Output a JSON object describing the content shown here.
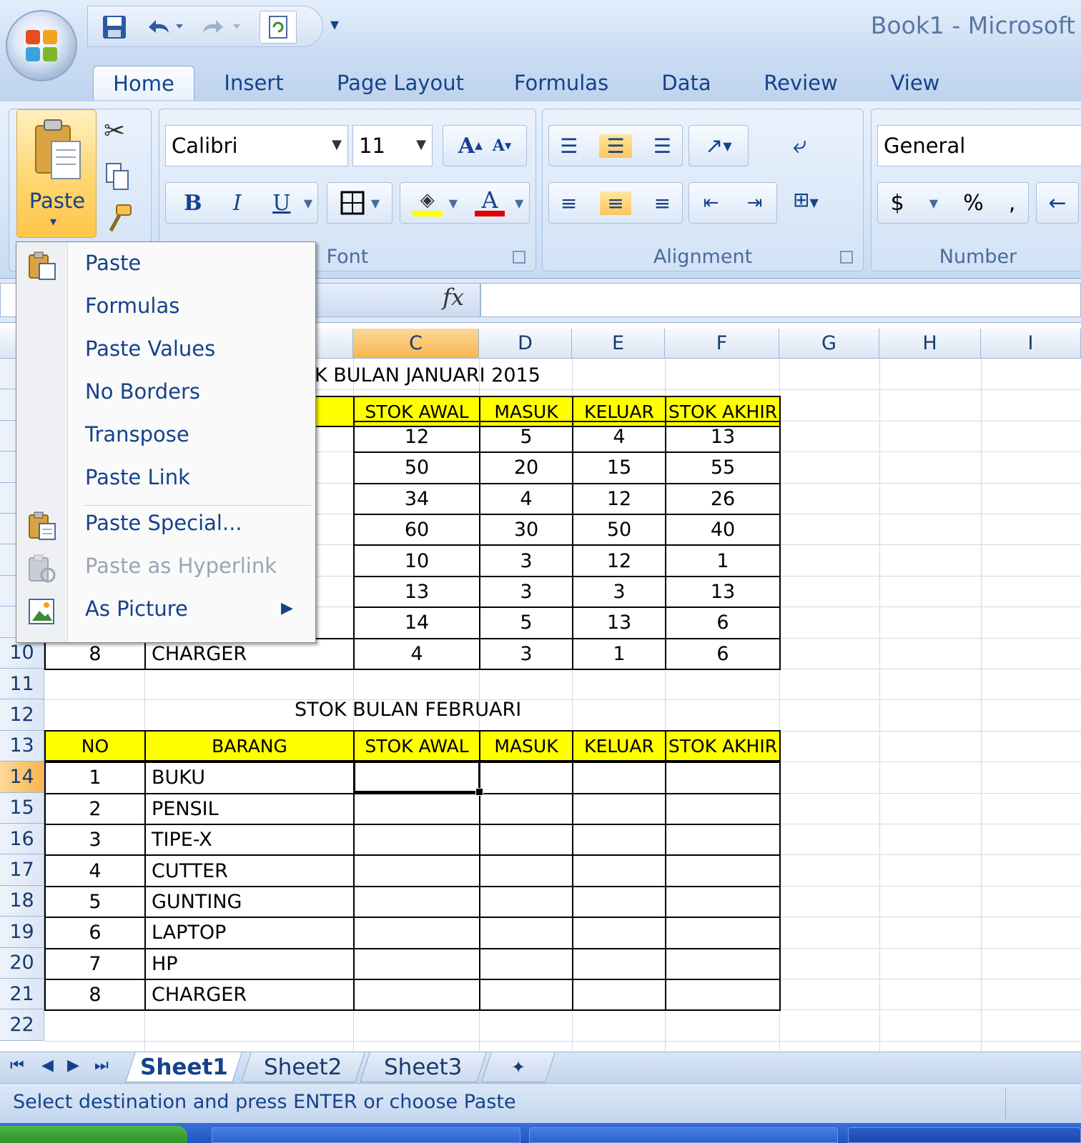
{
  "window": {
    "title": "Book1  -  Microsoft"
  },
  "ribbon_tabs": [
    "Home",
    "Insert",
    "Page Layout",
    "Formulas",
    "Data",
    "Review",
    "View"
  ],
  "clipboard": {
    "paste_label": "Paste"
  },
  "font": {
    "name": "Calibri",
    "size": "11",
    "bold": "B",
    "italic": "I",
    "underline": "U",
    "font_color_glyph": "A",
    "group_label": "Font",
    "grow": "A",
    "shrink": "A"
  },
  "alignment": {
    "group_label": "Alignment"
  },
  "number": {
    "format": "General",
    "currency": "$",
    "percent": "%",
    "comma": ",",
    "group_label": "Number"
  },
  "formula_bar": {
    "fx": "fx",
    "value": ""
  },
  "columns": [
    "C",
    "D",
    "E",
    "F",
    "G",
    "H",
    "I"
  ],
  "rows": [
    "10",
    "11",
    "12",
    "13",
    "14",
    "15",
    "16",
    "17",
    "18",
    "19",
    "20",
    "21",
    "22"
  ],
  "table1": {
    "title_visible": "K BULAN JANUARI 2015",
    "headers": [
      "STOK AWAL",
      "MASUK",
      "KELUAR",
      "STOK AKHIR"
    ],
    "rows": [
      [
        "12",
        "5",
        "4",
        "13"
      ],
      [
        "50",
        "20",
        "15",
        "55"
      ],
      [
        "34",
        "4",
        "12",
        "26"
      ],
      [
        "60",
        "30",
        "50",
        "40"
      ],
      [
        "10",
        "3",
        "12",
        "1"
      ],
      [
        "13",
        "3",
        "3",
        "13"
      ],
      [
        "14",
        "5",
        "13",
        "6"
      ]
    ],
    "last_row": [
      "8",
      "CHARGER",
      "4",
      "3",
      "1",
      "6"
    ]
  },
  "table2": {
    "title": "STOK BULAN FEBRUARI",
    "headers": [
      "NO",
      "BARANG",
      "STOK AWAL",
      "MASUK",
      "KELUAR",
      "STOK AKHIR"
    ],
    "rows": [
      [
        "1",
        "BUKU"
      ],
      [
        "2",
        "PENSIL"
      ],
      [
        "3",
        "TIPE-X"
      ],
      [
        "4",
        "CUTTER"
      ],
      [
        "5",
        "GUNTING"
      ],
      [
        "6",
        "LAPTOP"
      ],
      [
        "7",
        "HP"
      ],
      [
        "8",
        "CHARGER"
      ]
    ]
  },
  "paste_menu": {
    "items": [
      "Paste",
      "Formulas",
      "Paste Values",
      "No Borders",
      "Transpose",
      "Paste Link",
      "Paste Special...",
      "Paste as Hyperlink",
      "As Picture"
    ],
    "disabled": [
      "Paste as Hyperlink"
    ]
  },
  "sheets": [
    "Sheet1",
    "Sheet2",
    "Sheet3"
  ],
  "active_sheet": "Sheet1",
  "status": "Select destination and press ENTER or choose Paste",
  "colors": {
    "header_yellow": "#ffff00",
    "selection_orange": "#f8b54d",
    "ribbon_blue": "#15428b"
  }
}
